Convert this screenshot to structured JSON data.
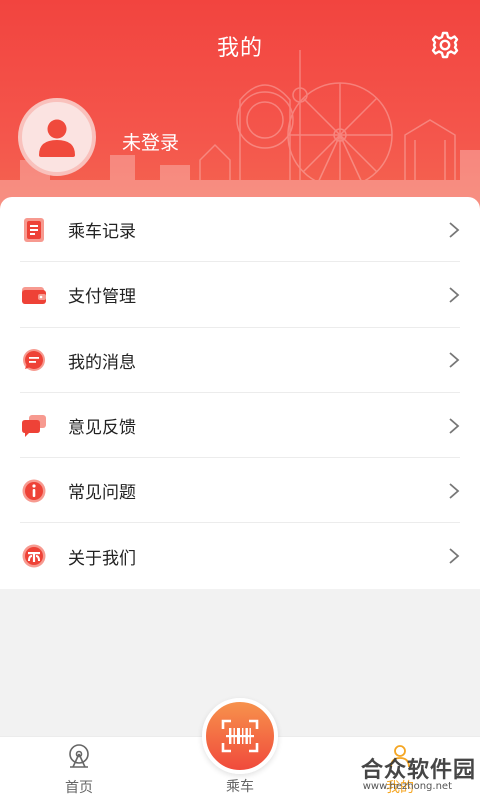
{
  "header": {
    "title": "我的",
    "login_status": "未登录",
    "icons": {
      "settings": "gear-icon",
      "avatar": "user-avatar-icon"
    }
  },
  "menu": {
    "items": [
      {
        "label": "乘车记录",
        "icon": "ride-record-icon"
      },
      {
        "label": "支付管理",
        "icon": "wallet-icon"
      },
      {
        "label": "我的消息",
        "icon": "message-bubble-icon"
      },
      {
        "label": "意见反馈",
        "icon": "feedback-icon"
      },
      {
        "label": "常见问题",
        "icon": "info-icon"
      },
      {
        "label": "关于我们",
        "icon": "about-icon"
      }
    ]
  },
  "tabbar": {
    "home": "首页",
    "ride": "乘车",
    "mine": "我的",
    "active": "mine",
    "active_color": "#f5a623"
  },
  "colors": {
    "brand": "#f2443f",
    "scan_gradient_top": "#f7924c",
    "scan_gradient_bottom": "#f04a3c"
  },
  "watermark": {
    "text": "合众软件园",
    "url": "www.hezhong.net"
  }
}
